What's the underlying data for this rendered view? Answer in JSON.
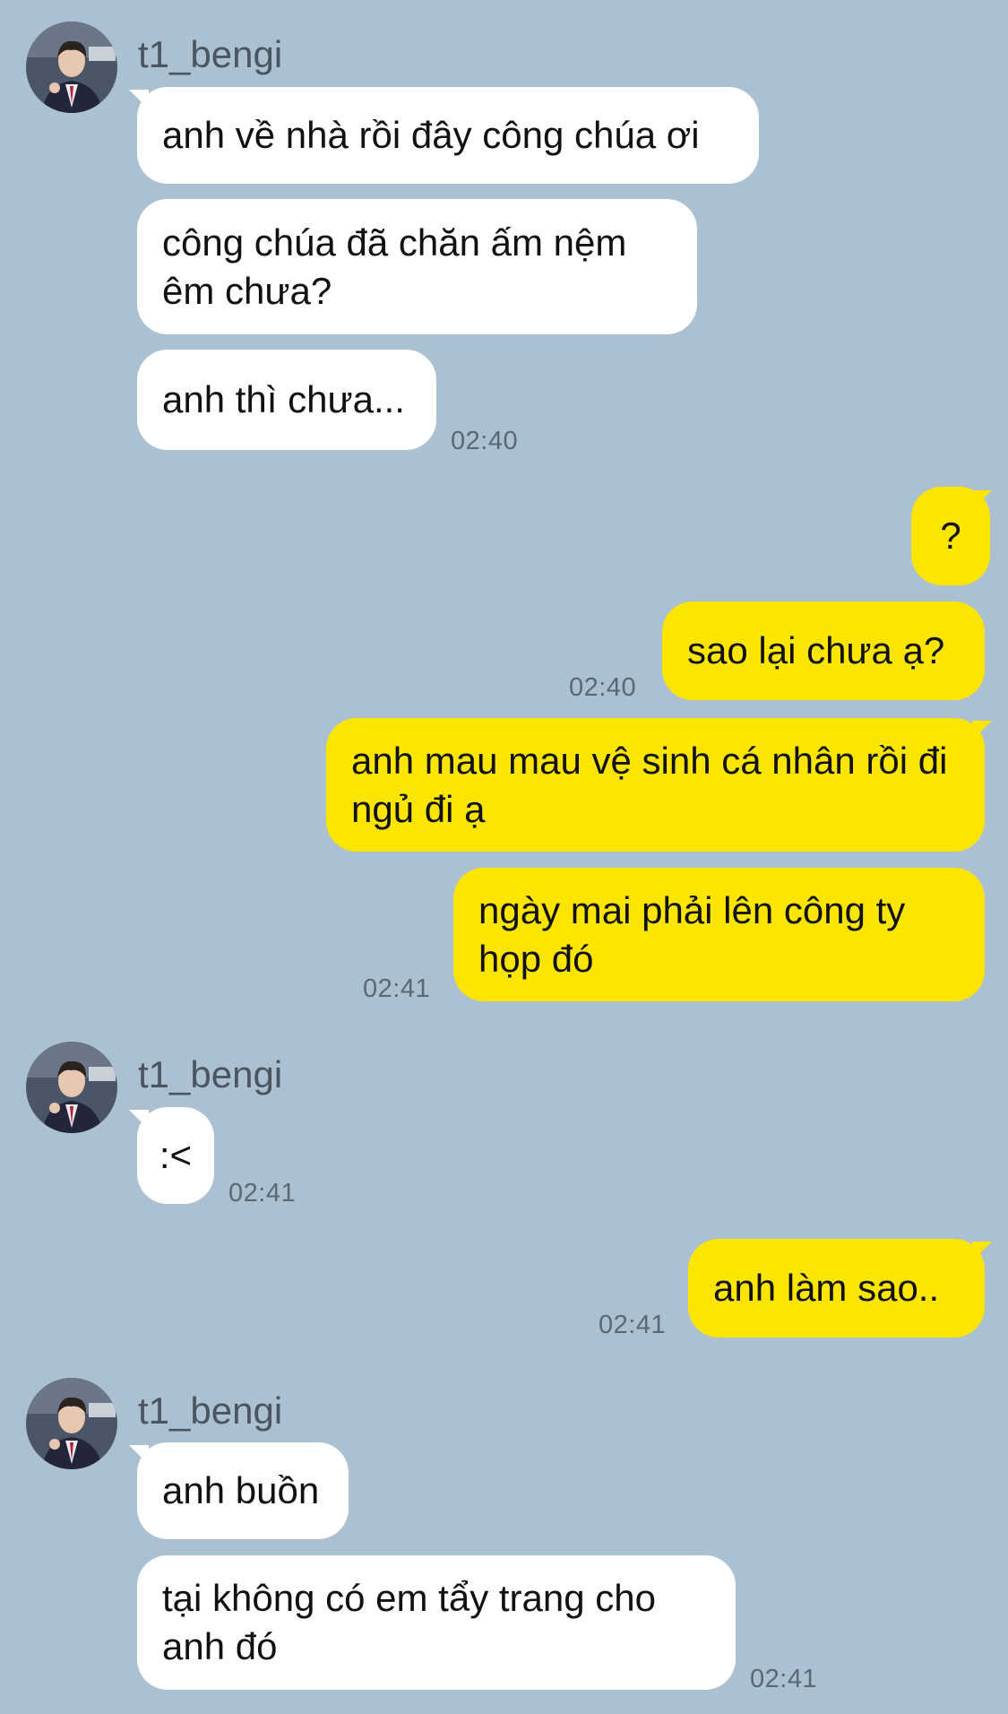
{
  "sender_name": "t1_bengi",
  "groups": [
    {
      "side": "in",
      "sender": "t1_bengi",
      "messages": [
        "anh về nhà rồi đây công chúa ơi",
        "công chúa đã chăn ấm nệm êm chưa?",
        "anh thì chưa..."
      ],
      "time": "02:40"
    },
    {
      "side": "out",
      "messages": [
        "?",
        "sao lại chưa ạ?"
      ],
      "time": "02:40"
    },
    {
      "side": "out",
      "messages": [
        "anh mau mau vệ sinh cá nhân rồi đi ngủ đi ạ",
        "ngày mai phải lên công ty họp đó"
      ],
      "time": "02:41"
    },
    {
      "side": "in",
      "sender": "t1_bengi",
      "messages": [
        ":<"
      ],
      "time": "02:41"
    },
    {
      "side": "out",
      "messages": [
        "anh làm sao.."
      ],
      "time": "02:41"
    },
    {
      "side": "in",
      "sender": "t1_bengi",
      "messages": [
        "anh buồn",
        "tại không có em tẩy trang cho anh đó"
      ],
      "time": "02:41"
    }
  ],
  "colors": {
    "background": "#abc1d1",
    "incoming_bubble": "#ffffff",
    "outgoing_bubble": "#fce500",
    "timestamp": "#5a6876"
  },
  "icons": {
    "avatar": "profile-photo"
  }
}
